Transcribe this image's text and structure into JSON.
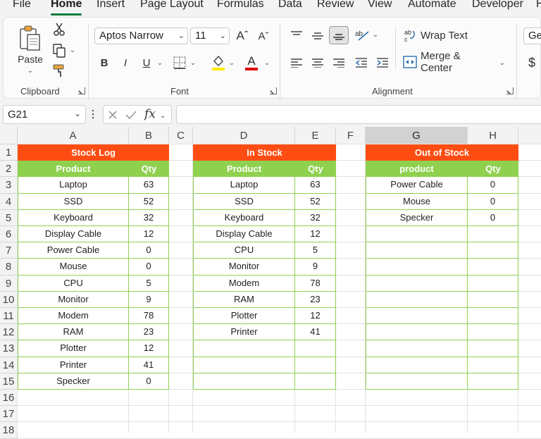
{
  "ribbon_tabs": [
    "File",
    "Home",
    "Insert",
    "Page Layout",
    "Formulas",
    "Data",
    "Review",
    "View",
    "Automate",
    "Developer",
    "H"
  ],
  "active_tab": "Home",
  "clipboard": {
    "paste_label": "Paste",
    "group_label": "Clipboard"
  },
  "font": {
    "name": "Aptos Narrow",
    "size": "11",
    "grow_label": "Aˆ",
    "shrink_label": "Aˇ",
    "bold": "B",
    "italic": "I",
    "underline": "U",
    "font_color_letter": "A",
    "group_label": "Font"
  },
  "alignment": {
    "wrap_text": "Wrap Text",
    "merge_center": "Merge & Center",
    "group_label": "Alignment"
  },
  "number": {
    "format_partial": "Gen",
    "currency_symbol": "$"
  },
  "formula_bar": {
    "name_box": "G21",
    "fx_label": "fx",
    "formula": ""
  },
  "columns": [
    "A",
    "B",
    "C",
    "D",
    "E",
    "F",
    "G",
    "H"
  ],
  "selected_column": "G",
  "rows": [
    "1",
    "2",
    "3",
    "4",
    "5",
    "6",
    "7",
    "8",
    "9",
    "10",
    "11",
    "12",
    "13",
    "14",
    "15",
    "16",
    "17",
    "18"
  ],
  "colors": {
    "title_fill": "#fe4d12",
    "header_fill": "#8fd14f",
    "accent": "#107c41"
  },
  "tables": [
    {
      "title": "Stock Log",
      "headers": [
        "Product",
        "Qty"
      ],
      "rows": [
        [
          "Laptop",
          "63"
        ],
        [
          "SSD",
          "52"
        ],
        [
          "Keyboard",
          "32"
        ],
        [
          "Display Cable",
          "12"
        ],
        [
          "Power Cable",
          "0"
        ],
        [
          "Mouse",
          "0"
        ],
        [
          "CPU",
          "5"
        ],
        [
          "Monitor",
          "9"
        ],
        [
          "Modem",
          "78"
        ],
        [
          "RAM",
          "23"
        ],
        [
          "Plotter",
          "12"
        ],
        [
          "Printer",
          "41"
        ],
        [
          "Specker",
          "0"
        ]
      ]
    },
    {
      "title": "In Stock",
      "headers": [
        "Product",
        "Qty"
      ],
      "rows": [
        [
          "Laptop",
          "63"
        ],
        [
          "SSD",
          "52"
        ],
        [
          "Keyboard",
          "32"
        ],
        [
          "Display Cable",
          "12"
        ],
        [
          "CPU",
          "5"
        ],
        [
          "Monitor",
          "9"
        ],
        [
          "Modem",
          "78"
        ],
        [
          "RAM",
          "23"
        ],
        [
          "Plotter",
          "12"
        ],
        [
          "Printer",
          "41"
        ],
        [
          "",
          ""
        ],
        [
          "",
          ""
        ],
        [
          "",
          ""
        ]
      ]
    },
    {
      "title": "Out of Stock",
      "headers": [
        "product",
        "Qty"
      ],
      "rows": [
        [
          "Power Cable",
          "0"
        ],
        [
          "Mouse",
          "0"
        ],
        [
          "Specker",
          "0"
        ],
        [
          "",
          ""
        ],
        [
          "",
          ""
        ],
        [
          "",
          ""
        ],
        [
          "",
          ""
        ],
        [
          "",
          ""
        ],
        [
          "",
          ""
        ],
        [
          "",
          ""
        ],
        [
          "",
          ""
        ],
        [
          "",
          ""
        ],
        [
          "",
          ""
        ]
      ]
    }
  ]
}
